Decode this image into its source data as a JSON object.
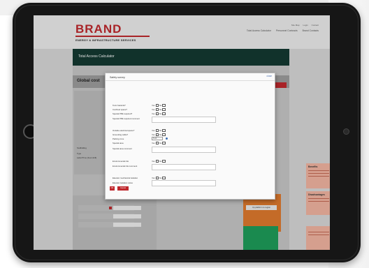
{
  "site": {
    "brand": "BRAND",
    "tagline": "ENERGY & INFRASTRUCTURE SERVICES",
    "util_links": [
      "Site Map",
      "Login",
      "Contact"
    ],
    "main_links": [
      "Total Access Calculator",
      "Personnel Contracts",
      "Brand Contacts"
    ]
  },
  "page": {
    "title": "Total Access Calculator",
    "section_title": "Global cost",
    "left_labels": [
      "Scaffolding",
      "Type",
      "Labor/Time (hour shift)"
    ],
    "orange_button": "Up platform to region",
    "benefits_title": "Benefits",
    "disadvantages_title": "Disadvantages"
  },
  "modal": {
    "title": "Safety survey",
    "close_label": "close",
    "yes_label": "Yes",
    "no_label": "No",
    "questions": [
      "Toxic hazards?",
      "Confined space?",
      "Special PPE required?",
      "Special PPE required comment",
      "Outside electrical space?",
      "Grounding cable?",
      "Parking zone",
      "Special area",
      "Special area comment",
      "Environmental risk",
      "Environmental risk comment",
      "Elevator mechanical isolation",
      "Elevator isolation notes"
    ],
    "parking_select": "5-10",
    "buttons": {
      "ok": "OK",
      "cancel": "Cancel"
    }
  },
  "colors": {
    "brand_red": "#c0282d",
    "title_bar": "#143a32",
    "green_card": "#1e9e5a",
    "orange_card": "#e07a2e",
    "benefits": "#f3b5a2"
  }
}
